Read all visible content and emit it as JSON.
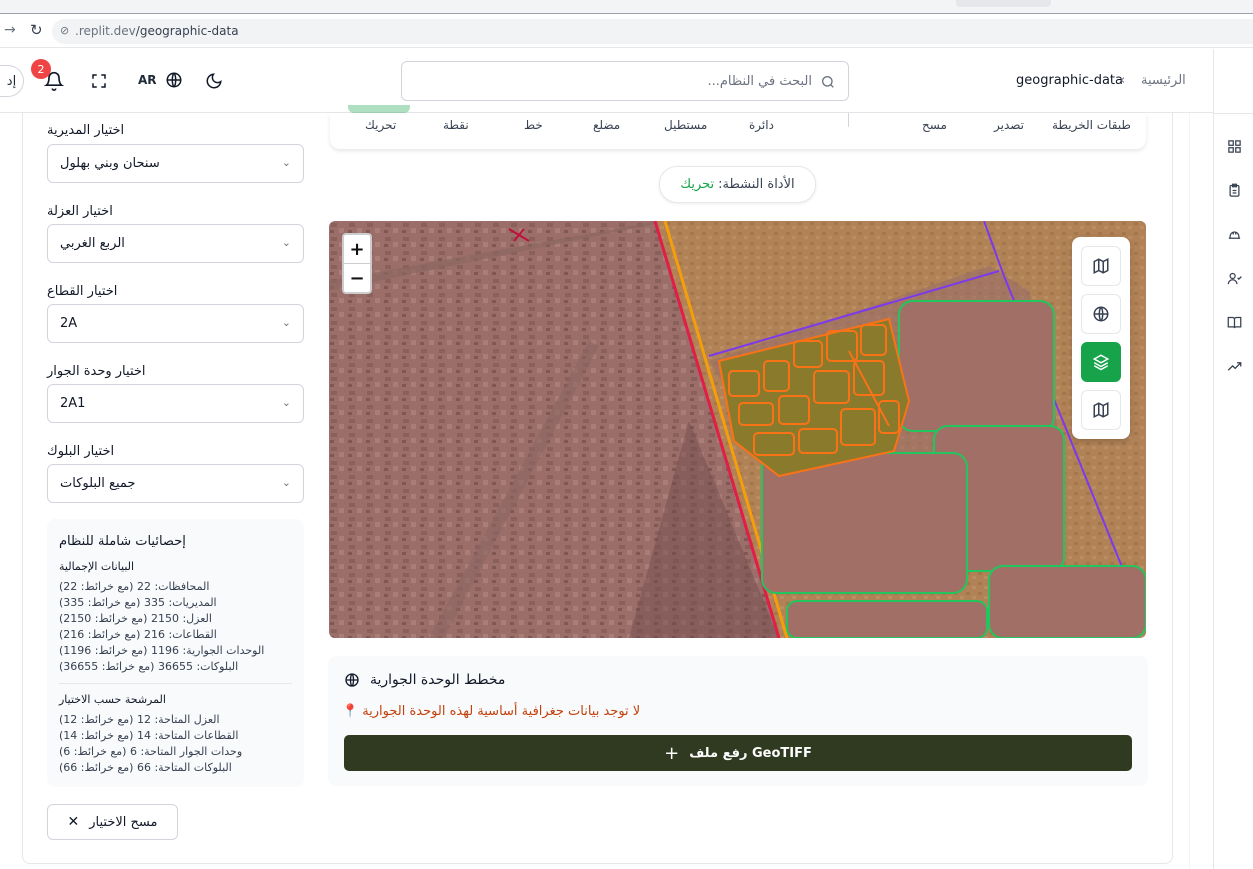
{
  "browser": {
    "url_prefix": ".replit.dev",
    "url_path": "/geographic-data"
  },
  "header": {
    "breadcrumb_home": "الرئيسية",
    "breadcrumb_sep": "‹",
    "breadcrumb_current": "geographic-data",
    "search_placeholder": "البحث في النظام...",
    "language": "AR",
    "notification_count": "2",
    "user_initial": "إد"
  },
  "filters": [
    {
      "label": "اختيار المديرية",
      "value": "سنحان وبني بهلول"
    },
    {
      "label": "اختيار العزلة",
      "value": "الربع الغربي"
    },
    {
      "label": "اختيار القطاع",
      "value": "2A"
    },
    {
      "label": "اختيار وحدة الجوار",
      "value": "2A1"
    },
    {
      "label": "اختيار البلوك",
      "value": "جميع البلوكات"
    }
  ],
  "stats": {
    "title": "إحصائيات شاملة للنظام",
    "totals_heading": "البيانات الإجمالية",
    "totals": [
      "المحافظات: 22 (مع خرائط: 22)",
      "المديريات: 335 (مع خرائط: 335)",
      "العزل: 2150 (مع خرائط: 2150)",
      "القطاعات: 216 (مع خرائط: 216)",
      "الوحدات الجوارية: 1196 (مع خرائط: 1196)",
      "البلوكات: 36655 (مع خرائط: 36655)"
    ],
    "filtered_heading": "المرشحة حسب الاختيار",
    "filtered": [
      "العزل المتاحة: 12 (مع خرائط: 12)",
      "القطاعات المتاحة: 14 (مع خرائط: 14)",
      "وحدات الجوار المتاحة: 6 (مع خرائط: 6)",
      "البلوكات المتاحة: 66 (مع خرائط: 66)"
    ]
  },
  "clear_button": "مسح الاختيار",
  "toolbar": {
    "layers": "طبقات الخريطة",
    "export": "تصدير",
    "clear": "مسح",
    "circle": "دائرة",
    "rectangle": "مستطيل",
    "polygon": "مضلع",
    "line": "خط",
    "point": "نقطة",
    "move": "تحريك"
  },
  "active_tool": {
    "label": "الأداة النشطة:",
    "value": "تحريك"
  },
  "map": {
    "zoom_in": "+",
    "zoom_out": "−"
  },
  "plan": {
    "title": "مخطط الوحدة الجوارية",
    "warning": "لا توجد بيانات جغرافية أساسية لهذه الوحدة الجوارية",
    "upload": "رفع ملف GeoTIFF"
  },
  "colors": {
    "accent_green": "#16a34a",
    "warning_orange": "#c2410c",
    "upload_dark": "#2f3a20",
    "notification_red": "#ef4444"
  }
}
